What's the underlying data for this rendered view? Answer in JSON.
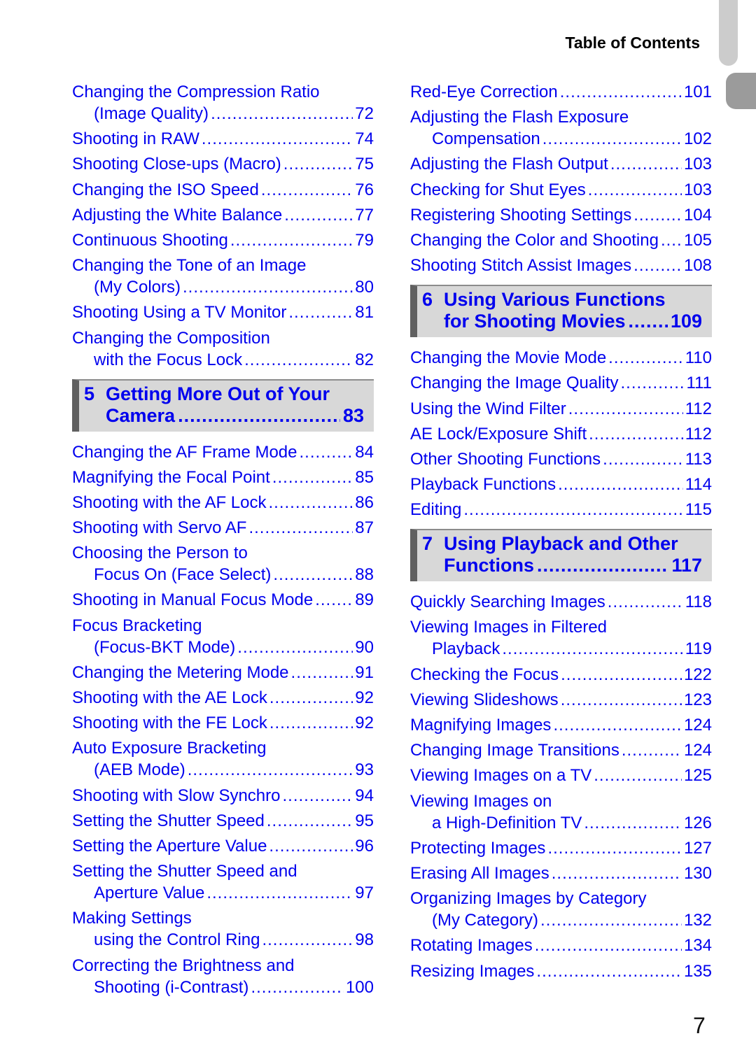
{
  "header": {
    "title": "Table of Contents"
  },
  "page_number": "7",
  "left_column": [
    {
      "type": "entry",
      "line1": "Changing the Compression Ratio",
      "line2": "(Image Quality)",
      "page": "72"
    },
    {
      "type": "entry",
      "line1": "Shooting in RAW",
      "page": "74"
    },
    {
      "type": "entry",
      "line1": "Shooting Close-ups (Macro)",
      "page": "75"
    },
    {
      "type": "entry",
      "line1": "Changing the ISO Speed",
      "page": "76"
    },
    {
      "type": "entry",
      "line1": "Adjusting the White Balance",
      "page": "77"
    },
    {
      "type": "entry",
      "line1": "Continuous Shooting",
      "page": "79"
    },
    {
      "type": "entry",
      "line1": "Changing the Tone of an Image",
      "line2": "(My Colors)",
      "page": "80"
    },
    {
      "type": "entry",
      "line1": "Shooting Using a TV Monitor",
      "page": "81"
    },
    {
      "type": "entry",
      "line1": "Changing the Composition",
      "line2": "with the Focus Lock",
      "page": "82"
    },
    {
      "type": "chapter",
      "number": "5",
      "line1": "Getting More Out of Your",
      "line2": "Camera",
      "page": "83"
    },
    {
      "type": "entry",
      "line1": "Changing the AF Frame Mode",
      "page": "84"
    },
    {
      "type": "entry",
      "line1": "Magnifying the Focal Point",
      "page": "85"
    },
    {
      "type": "entry",
      "line1": "Shooting with the AF Lock",
      "page": "86"
    },
    {
      "type": "entry",
      "line1": "Shooting with Servo AF",
      "page": "87"
    },
    {
      "type": "entry",
      "line1": "Choosing the Person to",
      "line2": "Focus On (Face Select)",
      "page": "88"
    },
    {
      "type": "entry",
      "line1": "Shooting in Manual Focus Mode",
      "page": "89"
    },
    {
      "type": "entry",
      "line1": "Focus Bracketing",
      "line2": "(Focus-BKT Mode)",
      "page": "90"
    },
    {
      "type": "entry",
      "line1": "Changing the Metering Mode",
      "page": "91"
    },
    {
      "type": "entry",
      "line1": "Shooting with the AE Lock",
      "page": "92"
    },
    {
      "type": "entry",
      "line1": "Shooting with the FE Lock",
      "page": "92"
    },
    {
      "type": "entry",
      "line1": "Auto Exposure Bracketing",
      "line2": "(AEB Mode)",
      "page": "93"
    },
    {
      "type": "entry",
      "line1": "Shooting with Slow Synchro",
      "page": "94"
    },
    {
      "type": "entry",
      "line1": "Setting the Shutter Speed",
      "page": "95"
    },
    {
      "type": "entry",
      "line1": "Setting the Aperture Value",
      "page": "96"
    },
    {
      "type": "entry",
      "line1": "Setting the Shutter Speed and",
      "line2": "Aperture Value",
      "page": "97"
    },
    {
      "type": "entry",
      "line1": "Making Settings",
      "line2": "using the Control Ring",
      "page": "98"
    },
    {
      "type": "entry",
      "line1": "Correcting the Brightness and",
      "line2": "Shooting (i-Contrast)",
      "page": "100"
    }
  ],
  "right_column": [
    {
      "type": "entry",
      "line1": "Red-Eye Correction",
      "page": "101"
    },
    {
      "type": "entry",
      "line1": "Adjusting the Flash Exposure",
      "line2": "Compensation",
      "page": "102"
    },
    {
      "type": "entry",
      "line1": "Adjusting the Flash Output",
      "page": "103"
    },
    {
      "type": "entry",
      "line1": "Checking for Shut Eyes",
      "page": "103"
    },
    {
      "type": "entry",
      "line1": "Registering Shooting Settings",
      "page": "104"
    },
    {
      "type": "entry",
      "line1": "Changing the Color and Shooting",
      "page": "105"
    },
    {
      "type": "entry",
      "line1": "Shooting Stitch Assist Images",
      "page": "108"
    },
    {
      "type": "chapter",
      "number": "6",
      "line1": "Using Various Functions",
      "line2": "for Shooting Movies",
      "page": "109"
    },
    {
      "type": "entry",
      "line1": "Changing the Movie Mode",
      "page": "110"
    },
    {
      "type": "entry",
      "line1": "Changing the Image Quality",
      "page": "111"
    },
    {
      "type": "entry",
      "line1": "Using the Wind Filter",
      "page": "112"
    },
    {
      "type": "entry",
      "line1": "AE Lock/Exposure Shift",
      "page": "112"
    },
    {
      "type": "entry",
      "line1": "Other Shooting Functions",
      "page": "113"
    },
    {
      "type": "entry",
      "line1": "Playback Functions",
      "page": "114"
    },
    {
      "type": "entry",
      "line1": "Editing",
      "page": "115"
    },
    {
      "type": "chapter",
      "number": "7",
      "line1": "Using Playback and Other",
      "line2": "Functions",
      "page": "117"
    },
    {
      "type": "entry",
      "line1": "Quickly Searching Images",
      "page": "118"
    },
    {
      "type": "entry",
      "line1": "Viewing Images in Filtered",
      "line2": "Playback",
      "page": "119"
    },
    {
      "type": "entry",
      "line1": "Checking the Focus",
      "page": "122"
    },
    {
      "type": "entry",
      "line1": "Viewing Slideshows",
      "page": "123"
    },
    {
      "type": "entry",
      "line1": "Magnifying Images",
      "page": "124"
    },
    {
      "type": "entry",
      "line1": "Changing Image Transitions",
      "page": "124"
    },
    {
      "type": "entry",
      "line1": "Viewing Images on a TV",
      "page": "125"
    },
    {
      "type": "entry",
      "line1": "Viewing Images on",
      "line2": "a High-Definition TV",
      "page": "126"
    },
    {
      "type": "entry",
      "line1": "Protecting Images",
      "page": "127"
    },
    {
      "type": "entry",
      "line1": "Erasing All Images",
      "page": "130"
    },
    {
      "type": "entry",
      "line1": "Organizing Images by Category",
      "line2": "(My Category)",
      "page": "132"
    },
    {
      "type": "entry",
      "line1": "Rotating Images",
      "page": "134"
    },
    {
      "type": "entry",
      "line1": "Resizing Images",
      "page": "135"
    }
  ]
}
